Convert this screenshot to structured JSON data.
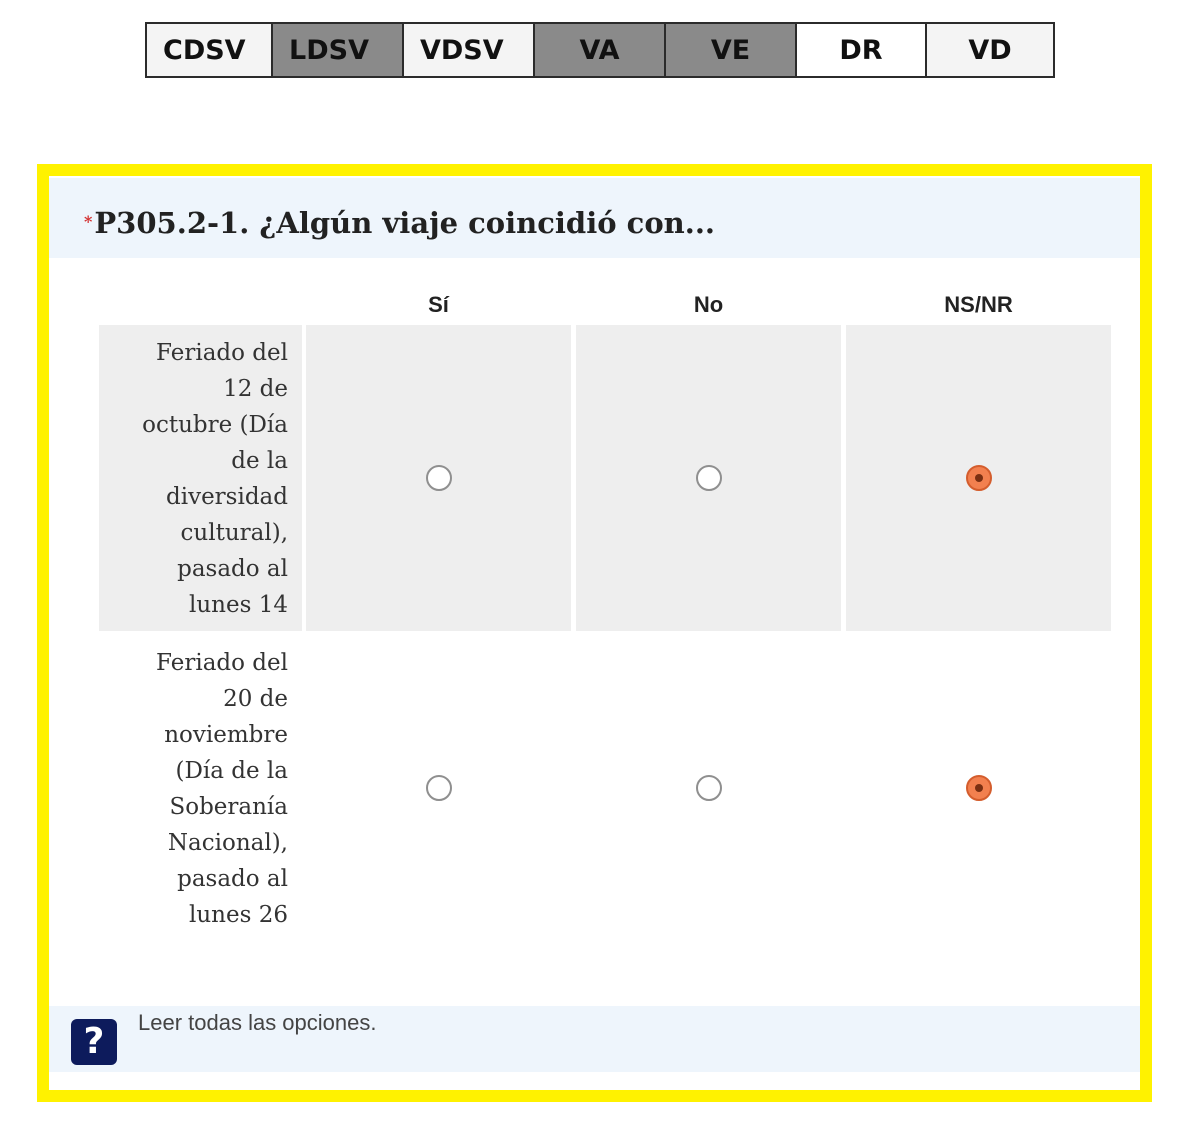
{
  "tabs": [
    {
      "label": "CDSV",
      "style": "light"
    },
    {
      "label": "LDSV",
      "style": "dark"
    },
    {
      "label": "VDSV",
      "style": "light"
    },
    {
      "label": "VA",
      "style": "dark"
    },
    {
      "label": "VE",
      "style": "dark"
    },
    {
      "label": "DR",
      "style": "white"
    },
    {
      "label": "VD",
      "style": "light"
    }
  ],
  "question": {
    "required_mark": "*",
    "title": "P305.2-1. ¿Algún viaje coincidió con..."
  },
  "columns": [
    "Sí",
    "No",
    "NS/NR"
  ],
  "rows": [
    {
      "label": "Feriado del 12 de octubre (Día de la diversidad cultural), pasado al lunes 14",
      "label_lines": [
        "Feriado del",
        "12 de",
        "octubre (Día",
        "de la",
        "diversidad",
        "cultural),",
        "pasado al",
        "lunes 14"
      ],
      "selected": "NS/NR"
    },
    {
      "label": "Feriado del 20 de noviembre (Día de la Soberanía Nacional), pasado al lunes 26",
      "label_lines": [
        "Feriado del",
        "20 de",
        "noviembre",
        "(Día de la",
        "Soberanía",
        "Nacional),",
        "pasado al",
        "lunes 26"
      ],
      "selected": "NS/NR"
    }
  ],
  "help": {
    "icon": "question-mark-icon",
    "icon_glyph": "?",
    "text": "Leer todas las opciones."
  },
  "colors": {
    "frame": "#fff200",
    "header_bg": "#eef5fc",
    "selected_radio": "#f2804f",
    "help_icon_bg": "#0d1b5c"
  }
}
